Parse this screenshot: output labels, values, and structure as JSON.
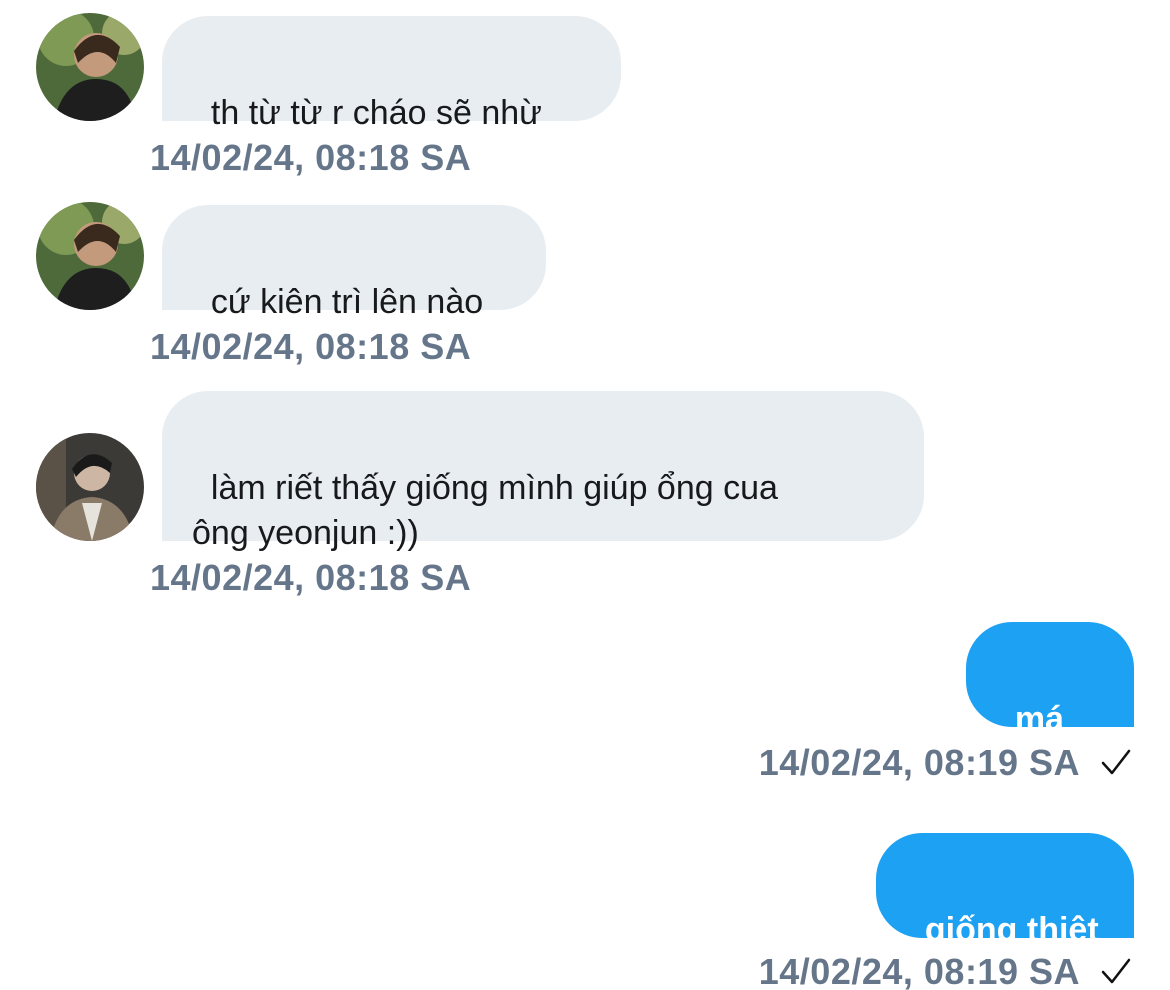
{
  "colors": {
    "incoming_bubble": "#e8edf1",
    "outgoing_bubble": "#1da1f2",
    "timestamp": "#66768a"
  },
  "messages": [
    {
      "direction": "incoming",
      "avatar": "avatar-photo-1",
      "text": "th từ từ r cháo sẽ nhừ",
      "timestamp": "14/02/24, 08:18 SA"
    },
    {
      "direction": "incoming",
      "avatar": "avatar-photo-1",
      "text": "cứ kiên trì lên nào",
      "timestamp": "14/02/24, 08:18 SA"
    },
    {
      "direction": "incoming",
      "avatar": "avatar-photo-2",
      "text": "làm riết thấy giống mình giúp ổng cua\nông yeonjun :))",
      "timestamp": "14/02/24, 08:18 SA"
    },
    {
      "direction": "outgoing",
      "text": "má :))",
      "timestamp": "14/02/24, 08:19 SA",
      "status_icon": "checkmark-icon"
    },
    {
      "direction": "outgoing",
      "text": "giống thiệt",
      "timestamp": "14/02/24, 08:19 SA",
      "status_icon": "checkmark-icon"
    }
  ]
}
